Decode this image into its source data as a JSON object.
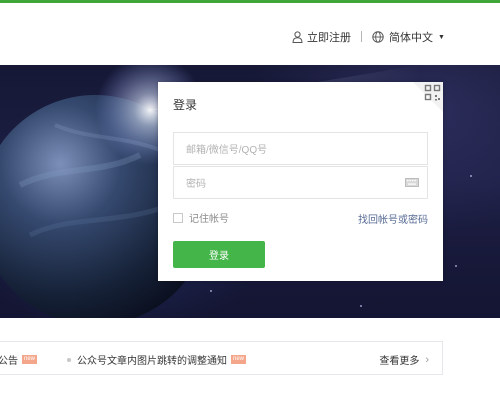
{
  "header": {
    "register_label": "立即注册",
    "language_label": "简体中文"
  },
  "login": {
    "title": "登录",
    "username_placeholder": "邮箱/微信号/QQ号",
    "password_placeholder": "密码",
    "remember_label": "记住帐号",
    "forgot_label": "找回帐号或密码",
    "submit_label": "登录"
  },
  "notices": {
    "items": [
      {
        "text": "公告",
        "badge": "new"
      },
      {
        "text": "公众号文章内图片跳转的调整通知",
        "badge": "new"
      }
    ],
    "more_label": "查看更多"
  },
  "colors": {
    "accent": "#41a63a",
    "button": "#44b549",
    "link": "#576b95"
  }
}
